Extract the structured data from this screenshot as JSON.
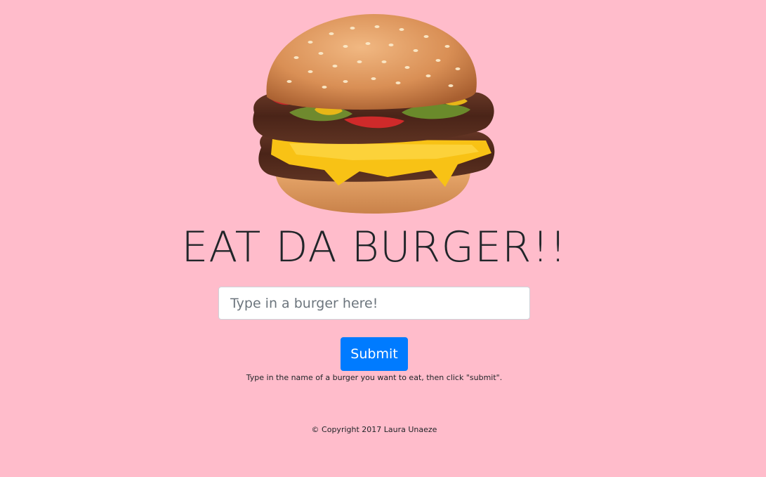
{
  "page": {
    "background_color": "#ffbccb"
  },
  "hero_image": {
    "icon": "burger-image"
  },
  "header": {
    "title": "EAT DA BURGER!!"
  },
  "form": {
    "input_placeholder": "Type in a burger here!",
    "input_value": "",
    "submit_label": "Submit",
    "submit_color": "#007bff",
    "help_text": "Type in the name of a burger you want to eat, then click \"submit\"."
  },
  "footer": {
    "copyright": "© Copyright 2017 Laura Unaeze"
  }
}
